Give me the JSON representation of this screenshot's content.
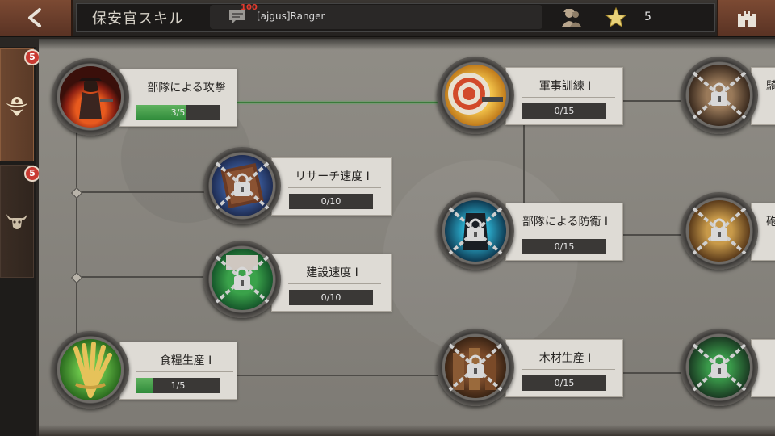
{
  "header": {
    "title": "保安官スキル",
    "chat_count": "100",
    "chat_text": "[ajgus]Ranger",
    "star_count": "5"
  },
  "sidebar": {
    "tabs": [
      {
        "icon": "cowboy-hat-icon",
        "badge": "5",
        "active": true
      },
      {
        "icon": "bull-skull-icon",
        "badge": "5",
        "active": false
      }
    ]
  },
  "skills": {
    "troop_attack": {
      "name": "部隊による攻撃",
      "progress": "3/5",
      "level": 3,
      "max": 5,
      "locked": false
    },
    "research_speed": {
      "name": "リサーチ速度 I",
      "progress": "0/10",
      "level": 0,
      "max": 10,
      "locked": true
    },
    "build_speed": {
      "name": "建設速度 I",
      "progress": "0/10",
      "level": 0,
      "max": 10,
      "locked": true
    },
    "food_production": {
      "name": "食糧生産 I",
      "progress": "1/5",
      "level": 1,
      "max": 5,
      "locked": false
    },
    "military_training": {
      "name": "軍事訓練 I",
      "progress": "0/15",
      "level": 0,
      "max": 15,
      "locked": false
    },
    "troop_defense": {
      "name": "部隊による防衛 I",
      "progress": "0/15",
      "level": 0,
      "max": 15,
      "locked": true
    },
    "wood_production": {
      "name": "木材生産 I",
      "progress": "0/15",
      "level": 0,
      "max": 15,
      "locked": true
    },
    "cavalry_partial": {
      "name": "騎",
      "locked": true
    },
    "artillery_partial": {
      "name": "砲",
      "locked": true
    },
    "unknown_partial": {
      "name": "",
      "locked": true
    }
  },
  "colors": {
    "progress_fill": "#3f9f48",
    "badge": "#c93a32",
    "tab_active": "#6c4730"
  }
}
